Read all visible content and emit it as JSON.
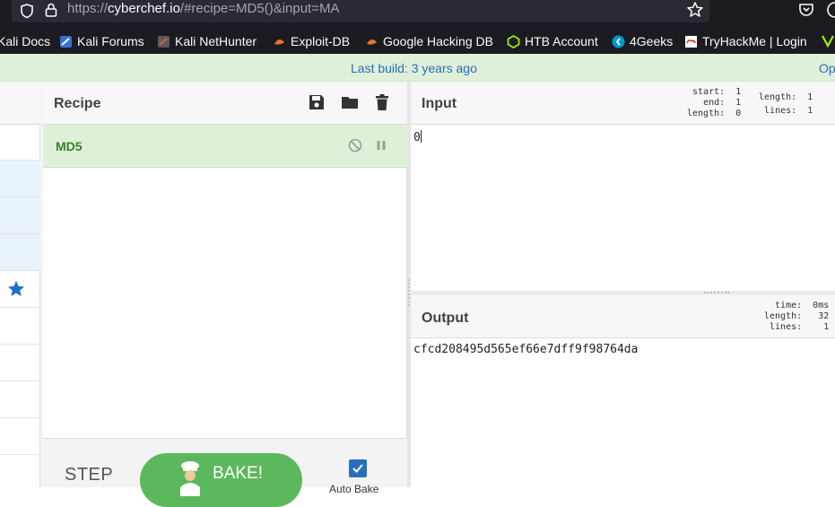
{
  "browser": {
    "url_scheme": "https://",
    "url_host": "cyberchef.io",
    "url_path": "/#recipe=MD5()&input=MA",
    "bookmarks": [
      {
        "label": "Kali Docs",
        "icon": "kali-docs-icon"
      },
      {
        "label": "Kali Forums",
        "icon": "kali-forums-icon"
      },
      {
        "label": "Kali NetHunter",
        "icon": "kali-nethunter-icon"
      },
      {
        "label": "Exploit-DB",
        "icon": "exploit-db-icon"
      },
      {
        "label": "Google Hacking DB",
        "icon": "ghdb-icon"
      },
      {
        "label": "HTB Account",
        "icon": "htb-icon"
      },
      {
        "label": "4Geeks",
        "icon": "4geeks-icon"
      },
      {
        "label": "TryHackMe | Login",
        "icon": "tryhackme-icon"
      }
    ]
  },
  "notice": {
    "build": "Last build: 3 years ago",
    "options": "Op"
  },
  "recipe": {
    "title": "Recipe",
    "operation": "MD5",
    "step_label": "STEP",
    "bake_label": "BAKE!",
    "auto_bake_label": "Auto Bake",
    "auto_bake_checked": true
  },
  "input": {
    "title": "Input",
    "stats_left": "start:  1\nend:  1\nlength:  0",
    "stats_right": "length:  1\nlines:  1",
    "value": "0"
  },
  "output": {
    "title": "Output",
    "stats": "time:  0ms\nlength:   32\nlines:    1",
    "value": "cfcd208495d565ef66e7dff9f98764da"
  },
  "colors": {
    "accent_blue": "#2a6ebb",
    "recipe_green": "#dff0d8",
    "bake_green": "#5cb85c"
  }
}
